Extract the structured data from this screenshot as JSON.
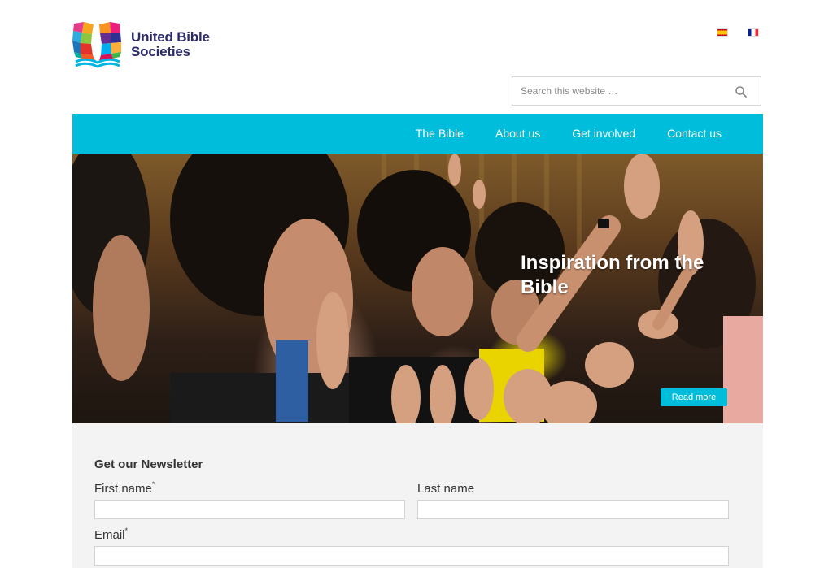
{
  "brand": {
    "name_line1": "United Bible",
    "name_line2": "Societies"
  },
  "languages": [
    {
      "icon": "spain-flag-icon",
      "color": "#c60b1e"
    },
    {
      "icon": "france-flag-icon",
      "color": "#002395"
    }
  ],
  "search": {
    "placeholder": "Search this website …",
    "value": "",
    "icon": "search-icon"
  },
  "nav": {
    "items": [
      {
        "label": "The Bible"
      },
      {
        "label": "About us"
      },
      {
        "label": "Get involved"
      },
      {
        "label": "Contact us"
      }
    ]
  },
  "hero": {
    "title": "Inspiration from the Bible",
    "button_label": "Read more"
  },
  "newsletter": {
    "title": "Get our Newsletter",
    "first_name_label": "First name",
    "last_name_label": "Last name",
    "email_label": "Email",
    "required_marker": "*",
    "first_name_value": "",
    "last_name_value": "",
    "email_value": ""
  },
  "colors": {
    "accent": "#00bddb",
    "brand_text": "#2b2a6b",
    "newsletter_bg": "#f3f3f3"
  }
}
